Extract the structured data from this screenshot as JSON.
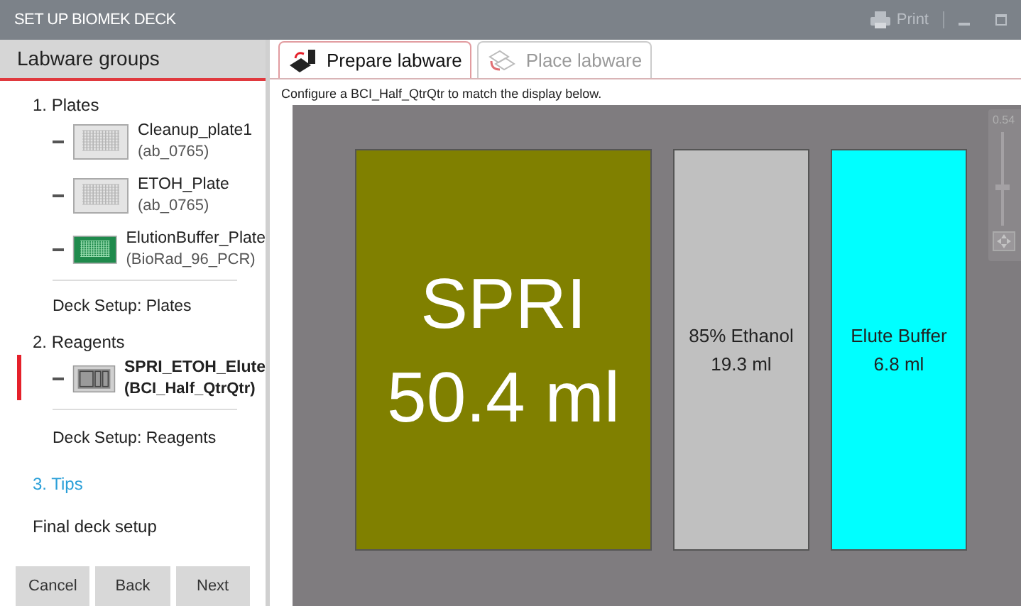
{
  "window": {
    "title": "SET UP BIOMEK DECK",
    "print": "Print"
  },
  "sidebar": {
    "header": "Labware groups",
    "groups": [
      {
        "title": "1. Plates",
        "highlighted": false,
        "items": [
          {
            "name": "Cleanup_plate1",
            "type": "(ab_0765)",
            "kind": "plate",
            "color": "#e4e4e4",
            "selected": false
          },
          {
            "name": "ETOH_Plate",
            "type": "(ab_0765)",
            "kind": "plate",
            "color": "#e4e4e4",
            "selected": false
          },
          {
            "name": "ElutionBuffer_Plate",
            "type": "(BioRad_96_PCR)",
            "kind": "plate",
            "color": "#1f8a4c",
            "selected": false
          }
        ],
        "setup": "Deck Setup: Plates"
      },
      {
        "title": "2. Reagents",
        "highlighted": false,
        "items": [
          {
            "name": "SPRI_ETOH_Elute",
            "type": "(BCI_Half_QtrQtr)",
            "kind": "reservoir",
            "color": "#8a8a8a",
            "selected": true
          }
        ],
        "setup": "Deck Setup: Reagents"
      },
      {
        "title": "3. Tips",
        "highlighted": true
      },
      {
        "title": "Final deck setup",
        "highlighted": false
      }
    ],
    "buttons": [
      "Cancel",
      "Back",
      "Next"
    ]
  },
  "tabs": [
    {
      "label": "Prepare labware",
      "selected": true
    },
    {
      "label": "Place labware",
      "selected": false
    }
  ],
  "instruction": "Configure a BCI_Half_QtrQtr to match the display below.",
  "deck": {
    "wells": [
      {
        "lines": [
          "SPRI",
          "50.4 ml"
        ],
        "color": "#808000",
        "kind": "wide"
      },
      {
        "lines": [
          "85% Ethanol",
          "19.3 ml"
        ],
        "color": "#c0c0c0",
        "kind": "narrow"
      },
      {
        "lines": [
          "Elute Buffer",
          "6.8 ml"
        ],
        "color": "#00ffff",
        "kind": "narrow"
      }
    ],
    "zoom": {
      "label": "0.54",
      "level": 0.4
    }
  }
}
